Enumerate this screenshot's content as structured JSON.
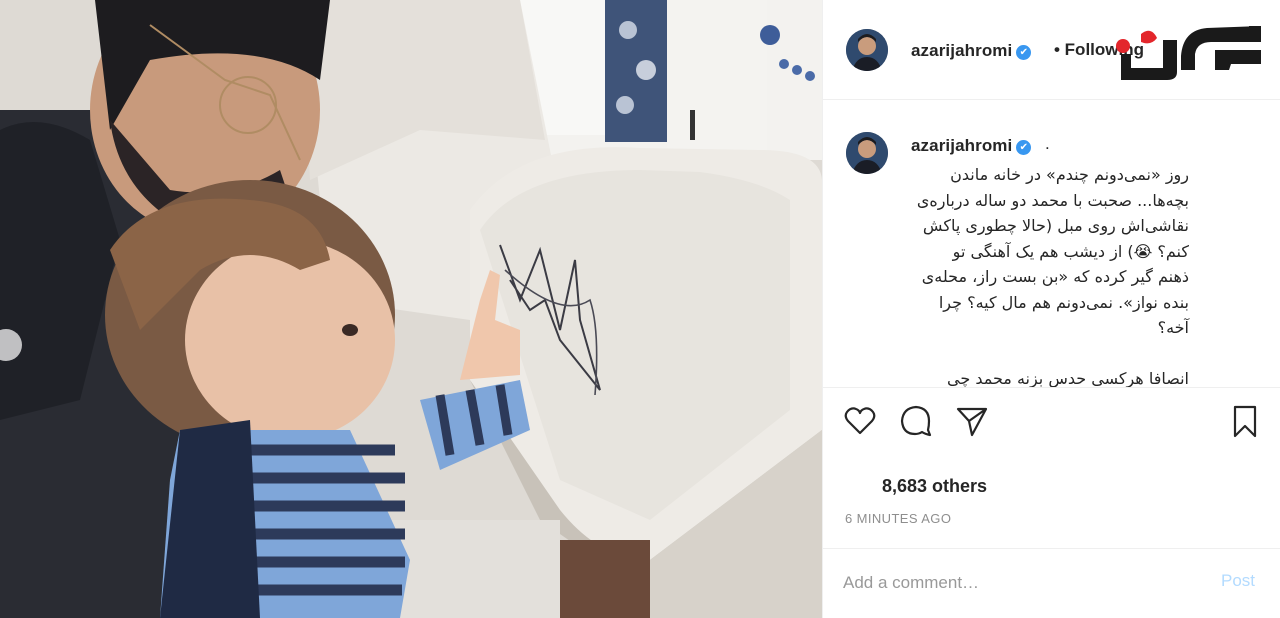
{
  "post": {
    "photo_alt": "Father and toddler looking at a drawing on a sofa"
  },
  "header": {
    "username": "azarijahromi",
    "verified_glyph": "✔",
    "follow_label": "• Following"
  },
  "brand": {
    "logo_icon": "rokna-logo"
  },
  "caption": {
    "username": "azarijahromi",
    "verified_glyph": "✔",
    "dot": ".",
    "text": "روز «نمی‌دونم چندم» در خانه ماندن\nبچه‌ها... صحبت با محمد دو ساله درباره‌ی\nنقاشی‌اش روی مبل (حالا چطوری پاکش\nکنم؟ 😭) از دیشب هم یک آهنگی تو\nذهنم گیر کرده که «بن بست راز، محله‌ی\nبنده نواز». نمی‌دونم هم مال کیه؟ چرا\nآخه؟\n\nانصافا هرکسی حدس بزنه محمد چی"
  },
  "actions": {
    "like_icon": "heart-icon",
    "comment_icon": "comment-icon",
    "share_icon": "share-icon",
    "save_icon": "bookmark-icon"
  },
  "likes": "8,683 others",
  "timestamp": "6 MINUTES AGO",
  "comment": {
    "placeholder": "Add a comment…",
    "post_label": "Post"
  },
  "colors": {
    "verified": "#3897f0",
    "post_button": "#b3dbff",
    "brand_red": "#e3262b",
    "muted": "#8e8e8e"
  }
}
